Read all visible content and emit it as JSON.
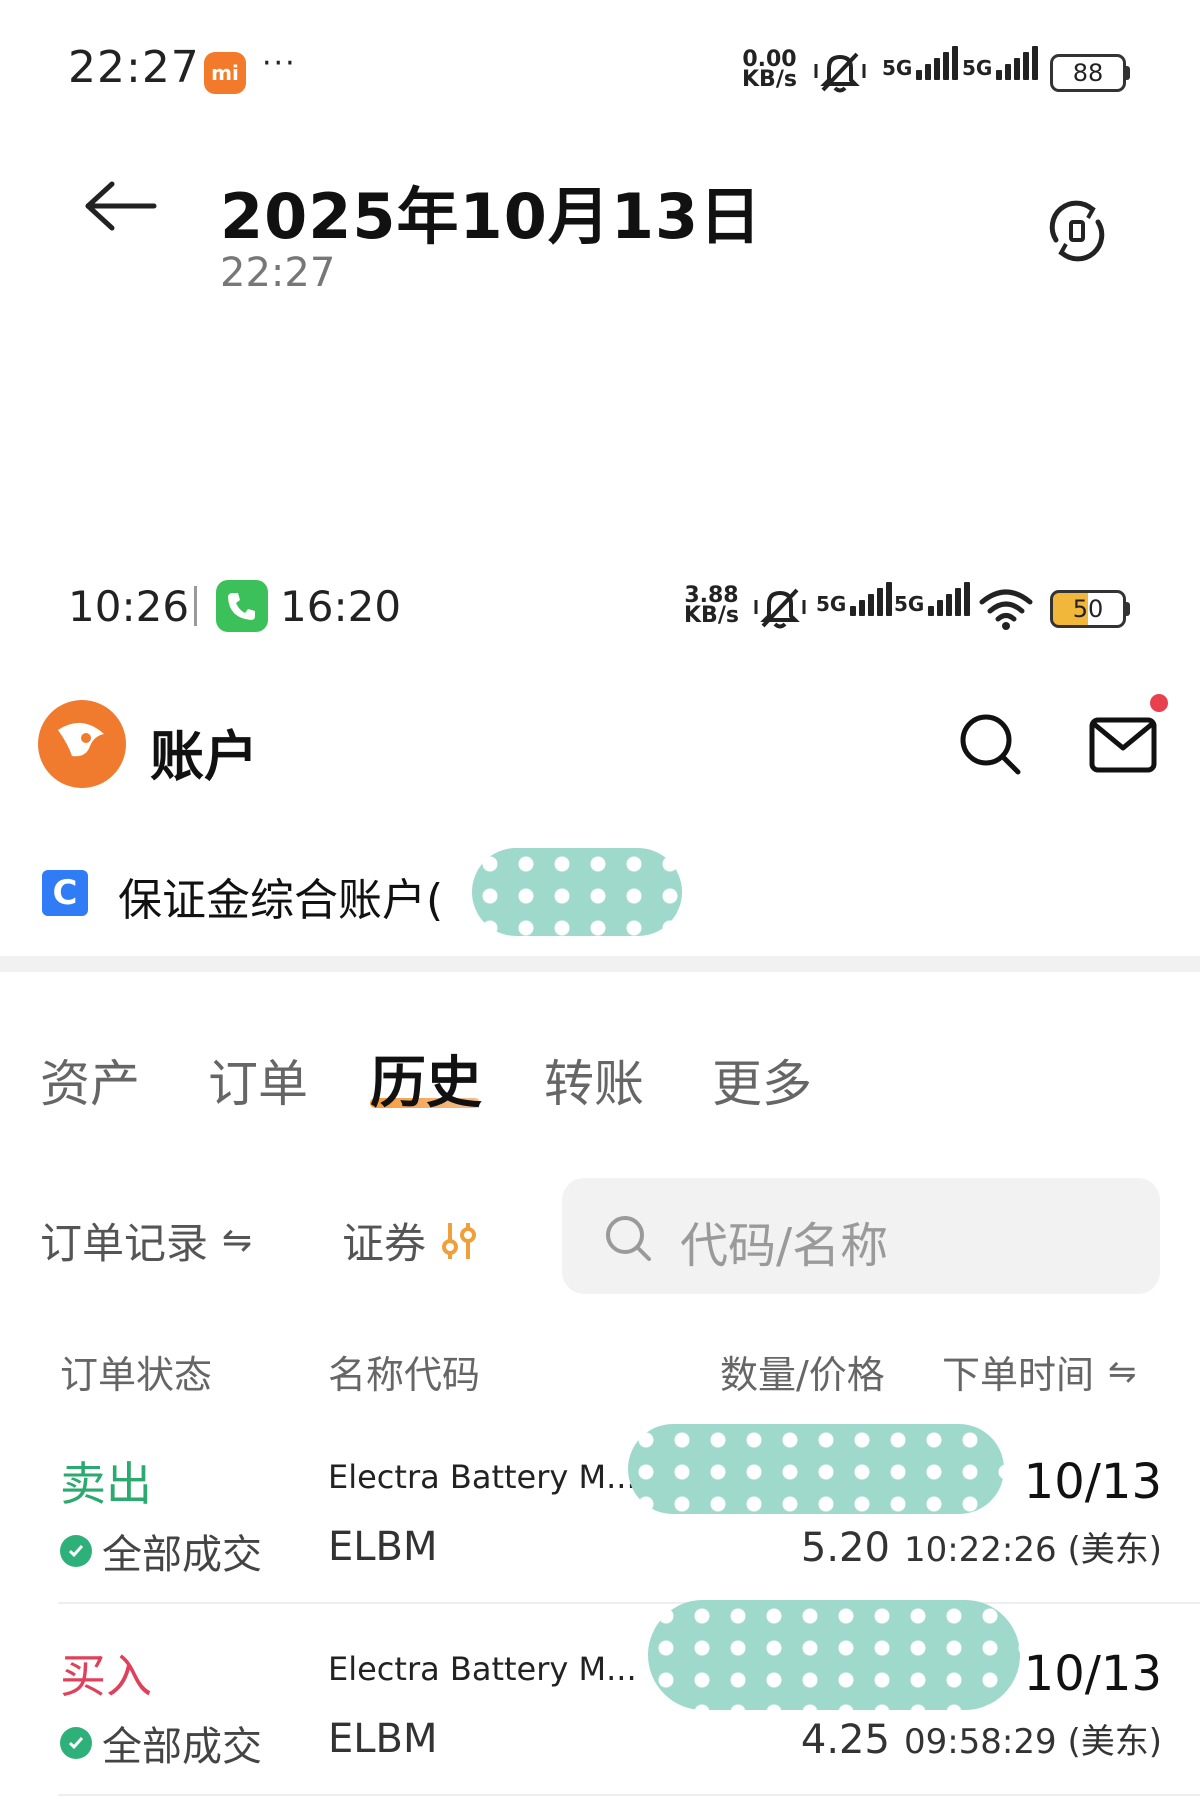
{
  "status_bar": {
    "time": "22:27",
    "mi_badge": "mi",
    "more": "···",
    "speed_value": "0.00",
    "speed_unit": "KB/s",
    "network_1": "5G",
    "network_2": "5G",
    "battery": "88"
  },
  "viewer": {
    "date": "2025年10月13日",
    "time": "22:27",
    "back_icon": "arrow-left-icon",
    "rotate_icon": "rotate-icon"
  },
  "inner_status_bar": {
    "time": "10:26",
    "call_time": "16:20",
    "speed_value": "3.88",
    "speed_unit": "KB/s",
    "network_1": "5G",
    "network_2": "5G",
    "battery": "50"
  },
  "app": {
    "title": "账户",
    "account_name": "保证金综合账户(",
    "account_icon_glyph": "C",
    "mail_badge_color": "#e8404f"
  },
  "tabs": [
    {
      "label": "资产"
    },
    {
      "label": "订单"
    },
    {
      "label": "历史"
    },
    {
      "label": "转账"
    },
    {
      "label": "更多"
    }
  ],
  "filters": {
    "records_label": "订单记录",
    "records_glyph": "⇋",
    "securities_label": "证券",
    "search_placeholder": "代码/名称"
  },
  "columns": {
    "status": "订单状态",
    "name_code": "名称代码",
    "qty_price": "数量/价格",
    "order_time": "下单时间",
    "sort_glyph": "⇋"
  },
  "orders": [
    {
      "side": "卖出",
      "status": "全部成交",
      "name": "Electra Battery M...",
      "code": "ELBM",
      "date": "10/13",
      "price": "5.20",
      "time": "10:22:26 (美东)"
    },
    {
      "side": "买入",
      "status": "全部成交",
      "name": "Electra Battery M...",
      "code": "ELBM",
      "date": "10/13",
      "price": "4.25",
      "time": "09:58:29 (美东)"
    }
  ],
  "colors": {
    "sell": "#2aaa6e",
    "buy": "#e0415a",
    "accent": "#f59a3b",
    "redaction": "#9fd9cc"
  }
}
